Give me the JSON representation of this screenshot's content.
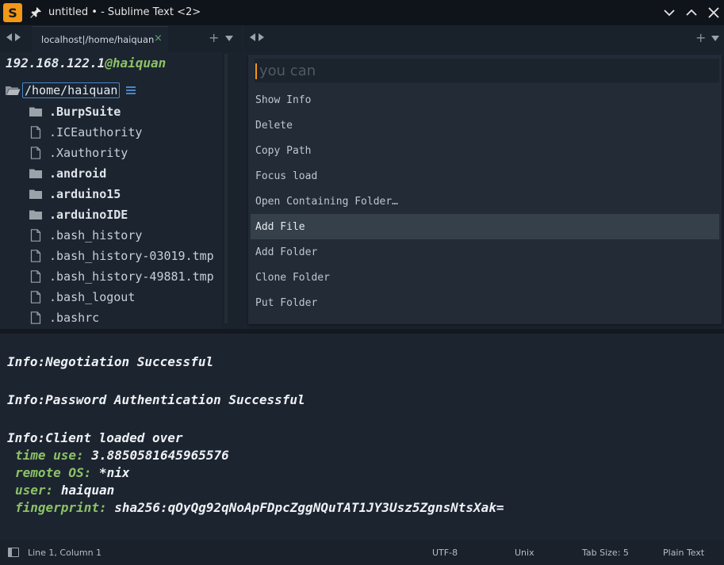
{
  "window": {
    "title": "untitled • - Sublime Text <2>",
    "app_icon_glyph": "S",
    "accent": "#f29718"
  },
  "tabs_left": {
    "tab_label": "localhost|/home/haiquan",
    "close_glyph": "×",
    "plus_glyph": "+"
  },
  "tabs_right": {
    "plus_glyph": "+"
  },
  "sidebar": {
    "host_ip": "192.168.122.1",
    "host_user": "@haiquan",
    "root_path": "/home/haiquan",
    "items": [
      {
        "name": ".BurpSuite",
        "type": "folder"
      },
      {
        "name": ".ICEauthority",
        "type": "file"
      },
      {
        "name": ".Xauthority",
        "type": "file"
      },
      {
        "name": ".android",
        "type": "folder"
      },
      {
        "name": ".arduino15",
        "type": "folder"
      },
      {
        "name": ".arduinoIDE",
        "type": "folder"
      },
      {
        "name": ".bash_history",
        "type": "file"
      },
      {
        "name": ".bash_history-03019.tmp",
        "type": "file"
      },
      {
        "name": ".bash_history-49881.tmp",
        "type": "file"
      },
      {
        "name": ".bash_logout",
        "type": "file"
      },
      {
        "name": ".bashrc",
        "type": "file"
      }
    ]
  },
  "palette": {
    "query": "you can",
    "items": [
      "Show Info",
      "Delete",
      "Copy Path",
      "Focus load",
      "Open Containing Folder…",
      "Add File",
      "Add Folder",
      "Clone Folder",
      "Put Folder"
    ],
    "selected_index": 5
  },
  "output": {
    "line1": "Info:Negotiation Successful",
    "line2": "Info:Password Authentication Successful",
    "line3": "Info:Client loaded over",
    "time_key": "time use:",
    "time_val": "3.8850581645965576",
    "os_key": "remote OS:",
    "os_val": "*nix",
    "user_key": "user:",
    "user_val": "haiquan",
    "fp_key": "fingerprint:",
    "fp_val": "sha256:qOyQg92qNoApFDpcZggNQuTAT1JY3Usz5ZgnsNtsXak="
  },
  "statusbar": {
    "position": "Line 1, Column 1",
    "encoding": "UTF-8",
    "line_endings": "Unix",
    "tab_size": "Tab Size: 5",
    "syntax": "Plain Text"
  }
}
